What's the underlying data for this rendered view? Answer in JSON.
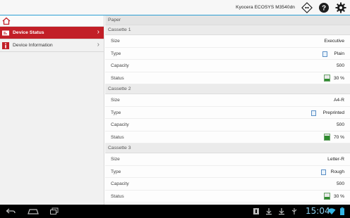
{
  "topbar": {
    "device_name": "Kyocera ECOSYS M3540dn",
    "accent_color": "#2c9fd4"
  },
  "sidebar": {
    "items": [
      {
        "label": "Device Status",
        "icon": "device-status-icon",
        "active": true
      },
      {
        "label": "Device Information",
        "icon": "info-icon",
        "active": false
      }
    ],
    "active_color": "#c21f27"
  },
  "main": {
    "section_title": "Paper",
    "cassettes": [
      {
        "title": "Cassette 1",
        "rows": [
          {
            "label": "Size",
            "value": "Executive"
          },
          {
            "label": "Type",
            "value": "Plain"
          },
          {
            "label": "Capacity",
            "value": "500"
          },
          {
            "label": "Status",
            "value": "30 %"
          }
        ],
        "level": 0.3
      },
      {
        "title": "Cassette 2",
        "rows": [
          {
            "label": "Size",
            "value": "A4-R"
          },
          {
            "label": "Type",
            "value": "Preprinted"
          },
          {
            "label": "Capacity",
            "value": "500"
          },
          {
            "label": "Status",
            "value": "70 %"
          }
        ],
        "level": 0.7
      },
      {
        "title": "Cassette 3",
        "rows": [
          {
            "label": "Size",
            "value": "Letter-R"
          },
          {
            "label": "Type",
            "value": "Rough"
          },
          {
            "label": "Capacity",
            "value": "500"
          },
          {
            "label": "Status",
            "value": "30 %"
          }
        ],
        "level": 0.3
      }
    ]
  },
  "system_bar": {
    "time": "15:04",
    "clock_color": "#8ed0ee"
  }
}
